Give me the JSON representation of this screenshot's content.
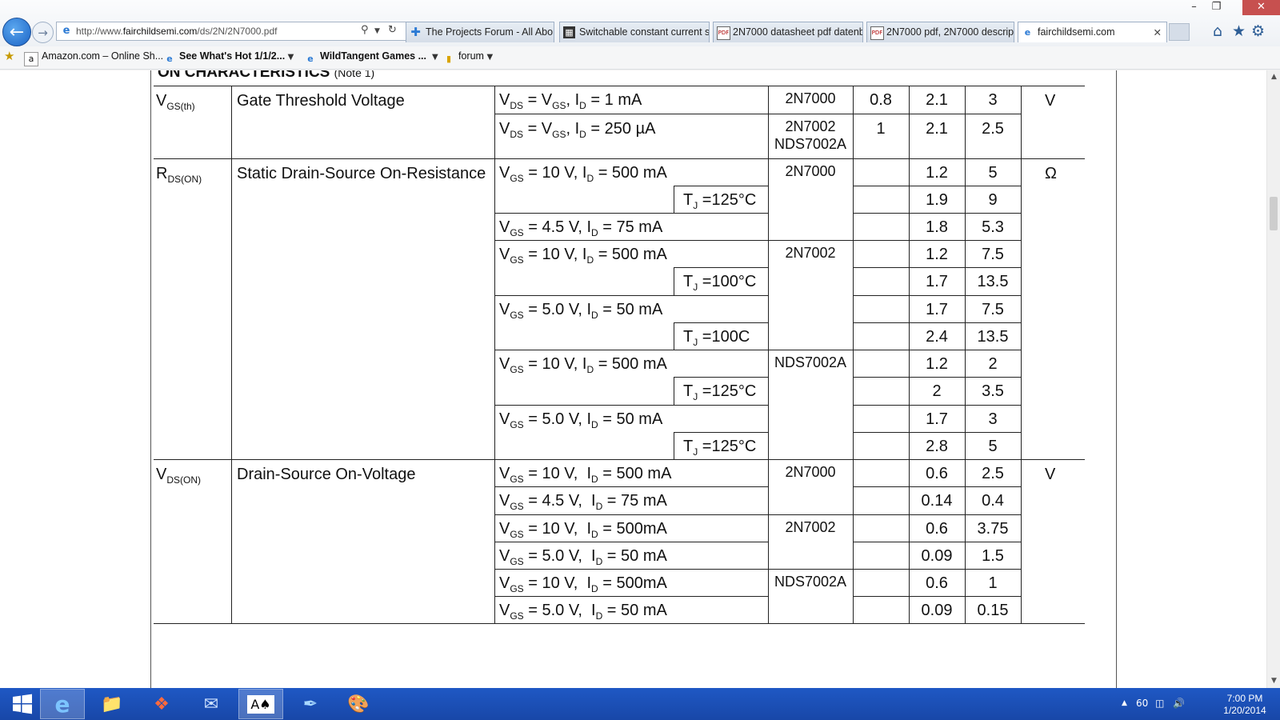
{
  "browser": {
    "address": {
      "prefix": "http://www.",
      "domain": "fairchildsemi.com",
      "path": "/ds/2N/2N7000.pdf"
    },
    "tabs": [
      {
        "label": "The Projects Forum - All Abo...",
        "icon": "plus-icon"
      },
      {
        "label": "Switchable constant current s...",
        "icon": "forum-icon"
      },
      {
        "label": "2N7000 datasheet pdf datenbl...",
        "icon": "pdf-icon"
      },
      {
        "label": "2N7000 pdf, 2N7000 descripti...",
        "icon": "pdf-icon"
      },
      {
        "label": "fairchildsemi.com",
        "icon": "ie-icon",
        "active": true
      }
    ],
    "favorites": [
      {
        "label": "Amazon.com – Online Sh..."
      },
      {
        "label": "See What's Hot 1/1/2..."
      },
      {
        "label": "WildTangent Games ..."
      },
      {
        "label": "forum"
      }
    ]
  },
  "datasheet": {
    "section": "ON CHARACTERISTICS",
    "note": "(Note 1)",
    "params": [
      {
        "symbol": "V",
        "symbol_sub": "GS(th)",
        "name": "Gate Threshold Voltage",
        "unit": "V"
      },
      {
        "symbol": "R",
        "symbol_sub": "DS(ON)",
        "name": "Static Drain-Source On-Resistance",
        "unit": "Ω"
      },
      {
        "symbol": "V",
        "symbol_sub": "DS(ON)",
        "name": "Drain-Source  On-Voltage",
        "unit": "V"
      }
    ],
    "rows": [
      {
        "cond": [
          [
            "V",
            "DS"
          ],
          [
            " = ",
            ""
          ],
          [
            "V",
            "GS"
          ],
          [
            ", ",
            ""
          ],
          [
            "I",
            "D"
          ],
          [
            " = 1 mA",
            ""
          ]
        ],
        "tj": "",
        "device": "2N7000",
        "min": "0.8",
        "typ": "2.1",
        "max": "3"
      },
      {
        "cond": [
          [
            "V",
            "DS"
          ],
          [
            " = ",
            ""
          ],
          [
            "V",
            "GS"
          ],
          [
            ", ",
            ""
          ],
          [
            "I",
            "D"
          ],
          [
            " = 250 µA",
            ""
          ]
        ],
        "tj": "",
        "device": "2N7002",
        "device2": "NDS7002A",
        "min": "1",
        "typ": "2.1",
        "max": "2.5"
      },
      {
        "cond": [
          [
            "V",
            "GS"
          ],
          [
            " = 10 V, ",
            ""
          ],
          [
            "I",
            "D"
          ],
          [
            " = 500 mA",
            ""
          ]
        ],
        "tj": "",
        "device": "2N7000",
        "min": "",
        "typ": "1.2",
        "max": "5"
      },
      {
        "cond": [],
        "tj": "T",
        "tj_rest": " =125°C",
        "device": "",
        "min": "",
        "typ": "1.9",
        "max": "9"
      },
      {
        "cond": [
          [
            "V",
            "GS"
          ],
          [
            " = 4.5 V, ",
            ""
          ],
          [
            "I",
            "D"
          ],
          [
            " = 75 mA",
            ""
          ]
        ],
        "tj": "",
        "device": "",
        "min": "",
        "typ": "1.8",
        "max": "5.3"
      },
      {
        "cond": [
          [
            "V",
            "GS"
          ],
          [
            " = 10 V, ",
            ""
          ],
          [
            "I",
            "D"
          ],
          [
            " = 500 mA",
            ""
          ]
        ],
        "tj": "",
        "device": "2N7002",
        "min": "",
        "typ": "1.2",
        "max": "7.5"
      },
      {
        "cond": [],
        "tj": "T",
        "tj_rest": " =100°C",
        "device": "",
        "min": "",
        "typ": "1.7",
        "max": "13.5"
      },
      {
        "cond": [
          [
            "V",
            "GS"
          ],
          [
            " = 5.0 V, ",
            ""
          ],
          [
            "I",
            "D"
          ],
          [
            " = 50 mA",
            ""
          ]
        ],
        "tj": "",
        "device": "",
        "min": "",
        "typ": "1.7",
        "max": "7.5"
      },
      {
        "cond": [],
        "tj": "T",
        "tj_rest": " =100C",
        "device": "",
        "min": "",
        "typ": "2.4",
        "max": "13.5"
      },
      {
        "cond": [
          [
            "V",
            "GS"
          ],
          [
            " = 10 V, ",
            ""
          ],
          [
            "I",
            "D"
          ],
          [
            " = 500 mA",
            ""
          ]
        ],
        "tj": "",
        "device": "NDS7002A",
        "min": "",
        "typ": "1.2",
        "max": "2"
      },
      {
        "cond": [],
        "tj": "T",
        "tj_rest": " =125°C",
        "device": "",
        "min": "",
        "typ": "2",
        "max": "3.5"
      },
      {
        "cond": [
          [
            "V",
            "GS"
          ],
          [
            " = 5.0 V, ",
            ""
          ],
          [
            "I",
            "D"
          ],
          [
            " = 50 mA",
            ""
          ]
        ],
        "tj": "",
        "device": "",
        "min": "",
        "typ": "1.7",
        "max": "3"
      },
      {
        "cond": [],
        "tj": "T",
        "tj_rest": " =125°C",
        "device": "",
        "min": "",
        "typ": "2.8",
        "max": "5"
      },
      {
        "cond": [
          [
            "V",
            "GS"
          ],
          [
            " = 10 V,  ",
            ""
          ],
          [
            "I",
            "D"
          ],
          [
            " = 500 mA",
            ""
          ]
        ],
        "tj": "",
        "device": "2N7000",
        "min": "",
        "typ": "0.6",
        "max": "2.5"
      },
      {
        "cond": [
          [
            "V",
            "GS"
          ],
          [
            " = 4.5 V,  ",
            ""
          ],
          [
            "I",
            "D"
          ],
          [
            " = 75 mA",
            ""
          ]
        ],
        "tj": "",
        "device": "",
        "min": "",
        "typ": "0.14",
        "max": "0.4"
      },
      {
        "cond": [
          [
            "V",
            "GS"
          ],
          [
            " = 10 V,  ",
            ""
          ],
          [
            "I",
            "D"
          ],
          [
            " = 500mA",
            ""
          ]
        ],
        "tj": "",
        "device": "2N7002",
        "min": "",
        "typ": "0.6",
        "max": "3.75"
      },
      {
        "cond": [
          [
            "V",
            "GS"
          ],
          [
            " = 5.0 V,  ",
            ""
          ],
          [
            "I",
            "D"
          ],
          [
            " = 50 mA",
            ""
          ]
        ],
        "tj": "",
        "device": "",
        "min": "",
        "typ": "0.09",
        "max": "1.5"
      },
      {
        "cond": [
          [
            "V",
            "GS"
          ],
          [
            " = 10 V,  ",
            ""
          ],
          [
            "I",
            "D"
          ],
          [
            " = 500mA",
            ""
          ]
        ],
        "tj": "",
        "device": "NDS7002A",
        "min": "",
        "typ": "0.6",
        "max": "1"
      },
      {
        "cond": [
          [
            "V",
            "GS"
          ],
          [
            " = 5.0 V,  ",
            ""
          ],
          [
            "I",
            "D"
          ],
          [
            " = 50 mA",
            ""
          ]
        ],
        "tj": "",
        "device": "",
        "min": "",
        "typ": "0.09",
        "max": "0.15"
      }
    ]
  },
  "taskbar": {
    "apps": [
      "windows-start-icon",
      "internet-explorer-icon",
      "file-explorer-icon",
      "puzzle-game-icon",
      "thunderbird-icon",
      "solitaire-icon",
      "syringe-icon",
      "paint-icon"
    ],
    "tray_value": "60",
    "time": "7:00 PM",
    "date": "1/20/2014"
  }
}
